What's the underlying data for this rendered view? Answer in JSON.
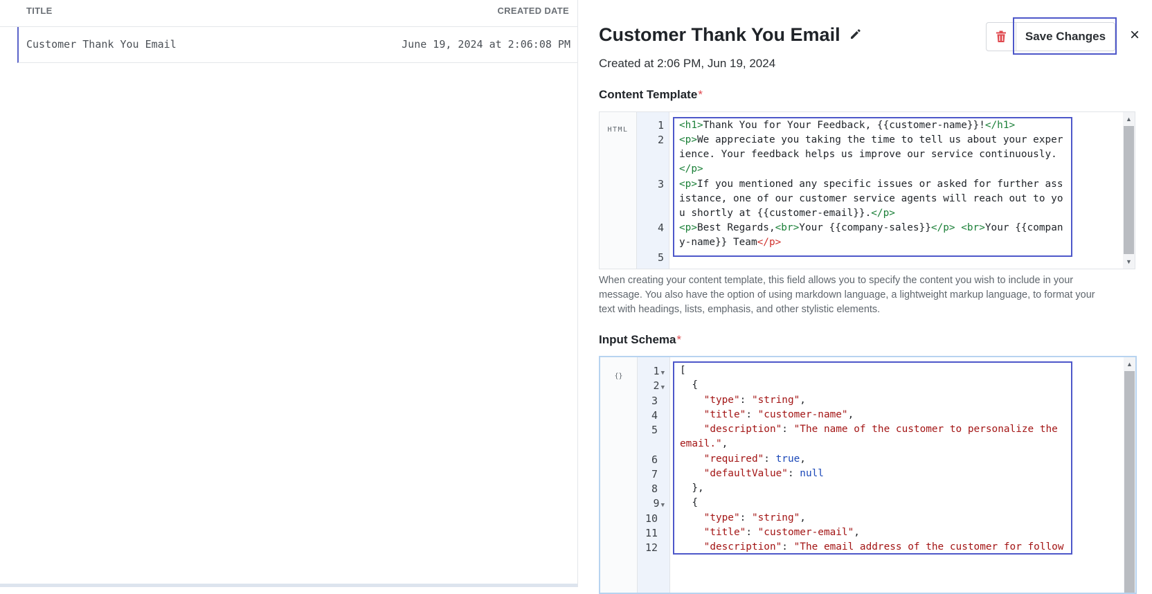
{
  "list": {
    "headers": {
      "title": "TITLE",
      "created_date": "CREATED DATE"
    },
    "rows": [
      {
        "title": "Customer Thank You Email",
        "created_date": "June 19, 2024 at 2:06:08 PM"
      }
    ]
  },
  "detail": {
    "title": "Customer Thank You Email",
    "created": "Created at 2:06 PM, Jun 19, 2024",
    "save_label": "Save Changes",
    "close_label": "×",
    "content_template": {
      "label": "Content Template",
      "required_mark": "*",
      "mode": "HTML",
      "line_numbers": [
        "1",
        "2",
        "3",
        "4",
        "5"
      ],
      "help": "When creating your content template, this field allows you to specify the content you wish to include in your message. You also have the option of using markdown language, a lightweight markup language, to format your text with headings, lists, emphasis, and other stylistic elements."
    },
    "input_schema": {
      "label": "Input Schema",
      "required_mark": "*",
      "mode": "{}",
      "line_numbers": [
        "1",
        "2",
        "3",
        "4",
        "5",
        "6",
        "7",
        "8",
        "9",
        "10",
        "11",
        "12"
      ]
    }
  },
  "colors": {
    "accent": "#4d57c9",
    "html_tag": "#1a7f37",
    "json_string": "#a31515",
    "json_keyword": "#1b48b8",
    "required": "#e0494f",
    "delete_icon": "#e0494f"
  },
  "icons": {
    "edit": "pencil-icon",
    "delete": "trash-icon",
    "close": "close-icon"
  }
}
